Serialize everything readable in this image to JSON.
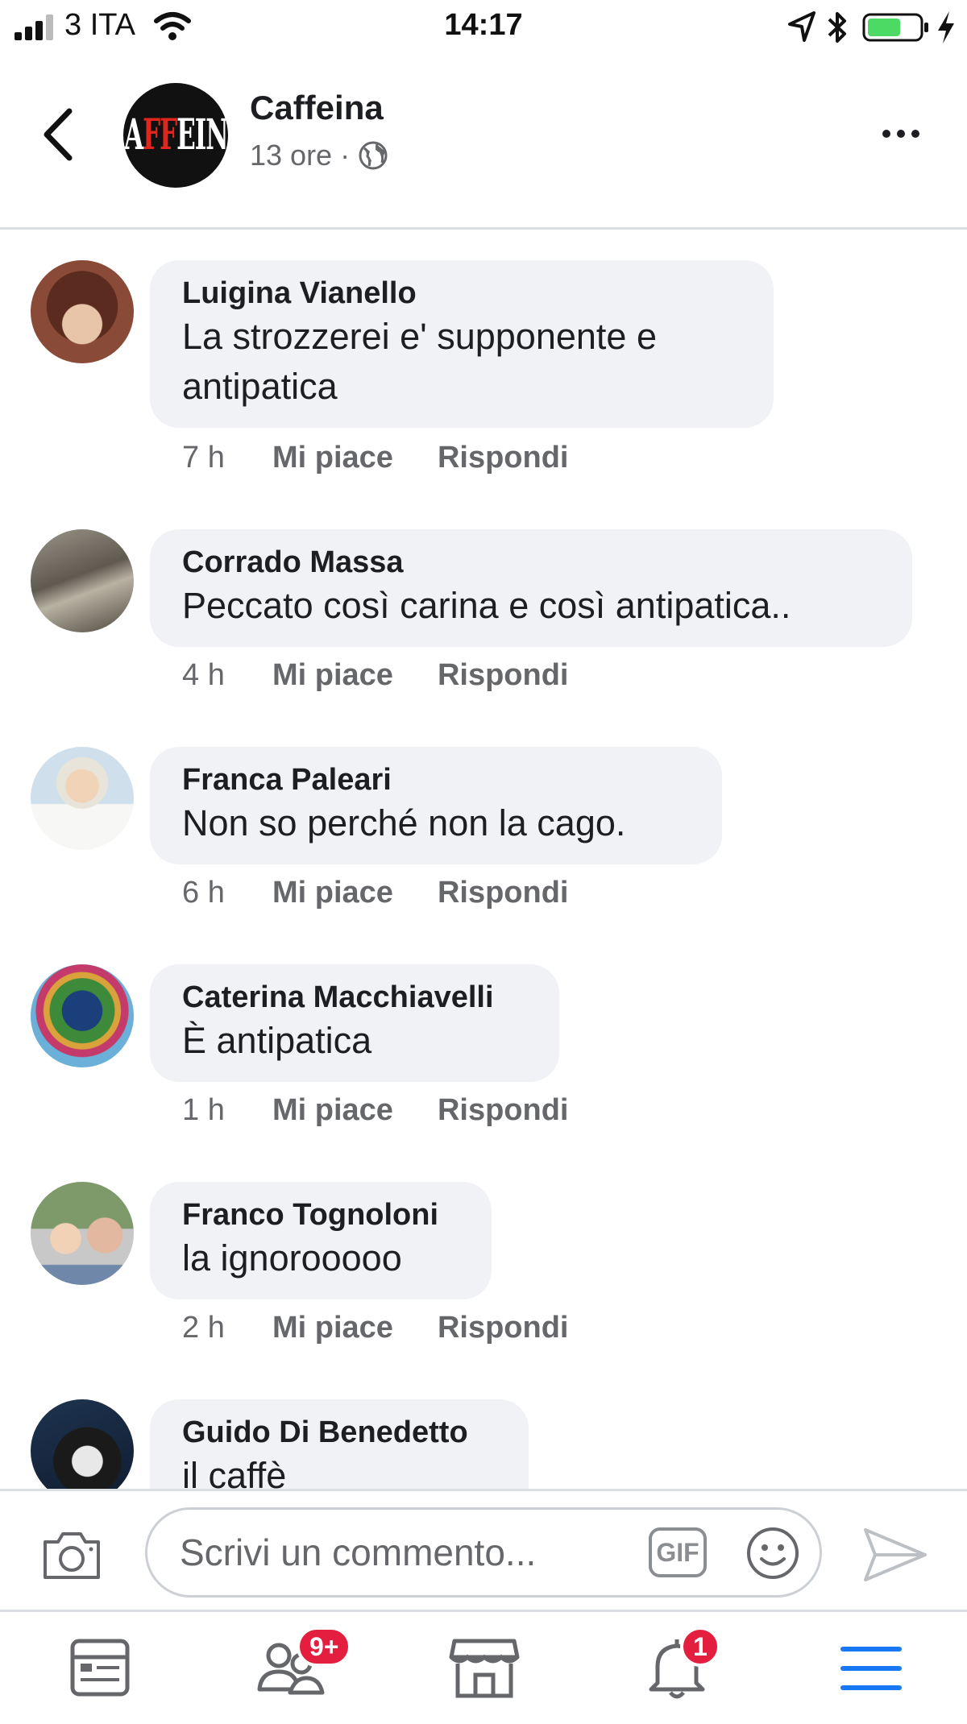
{
  "status_bar": {
    "carrier": "3 ITA",
    "time": "14:17"
  },
  "header": {
    "page_name": "Caffeina",
    "time_ago": "13 ore",
    "separator": "·",
    "logo_text_start": "CA",
    "logo_text_red": "FF",
    "logo_text_end": "EINA"
  },
  "comments": [
    {
      "author": "Luigina Vianello",
      "text": "La strozzerei  e' supponente e antipatica",
      "time": "7 h",
      "like": "Mi piace",
      "reply": "Rispondi"
    },
    {
      "author": "Corrado Massa",
      "text": "Peccato così carina e così antipatica..",
      "time": "4 h",
      "like": "Mi piace",
      "reply": "Rispondi"
    },
    {
      "author": "Franca Paleari",
      "text": "Non so perché non la cago.",
      "time": "6 h",
      "like": "Mi piace",
      "reply": "Rispondi"
    },
    {
      "author": "Caterina Macchiavelli",
      "text": "È antipatica",
      "time": "1 h",
      "like": "Mi piace",
      "reply": "Rispondi"
    },
    {
      "author": "Franco Tognoloni",
      "text": "la ignorooooo",
      "time": "2 h",
      "like": "Mi piace",
      "reply": "Rispondi"
    },
    {
      "author": "Guido Di Benedetto",
      "text": "il caffè"
    }
  ],
  "composer": {
    "placeholder": "Scrivi un commento...",
    "gif_label": "GIF"
  },
  "tabbar": {
    "friends_badge": "9+",
    "notifications_badge": "1"
  },
  "colors": {
    "badge": "#e41e3f",
    "menu_active": "#1877f2",
    "bubble": "#f0f2f5",
    "battery": "#4cd964"
  },
  "icons": [
    "signal-icon",
    "wifi-icon",
    "location-icon",
    "bluetooth-icon",
    "battery-icon",
    "charging-icon",
    "back-arrow-icon",
    "globe-icon",
    "more-options-icon",
    "camera-icon",
    "gif-icon",
    "emoji-icon",
    "send-icon",
    "news-feed-icon",
    "friends-icon",
    "marketplace-icon",
    "notifications-icon",
    "menu-icon"
  ]
}
